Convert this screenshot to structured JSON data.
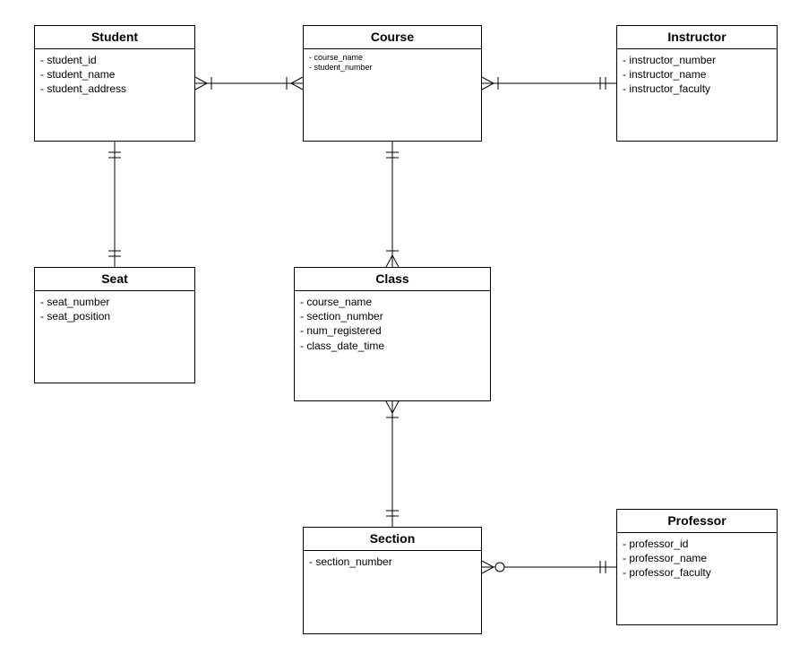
{
  "entities": {
    "student": {
      "title": "Student",
      "attributes": [
        "- student_id",
        "- student_name",
        "- student_address"
      ]
    },
    "course": {
      "title": "Course",
      "attributes": [
        "- course_name",
        "- student_number"
      ]
    },
    "instructor": {
      "title": "Instructor",
      "attributes": [
        "- instructor_number",
        "- instructor_name",
        "- instructor_faculty"
      ]
    },
    "seat": {
      "title": "Seat",
      "attributes": [
        "- seat_number",
        "- seat_position"
      ]
    },
    "class": {
      "title": "Class",
      "attributes": [
        "- course_name",
        "- section_number",
        "- num_registered",
        "- class_date_time"
      ]
    },
    "section": {
      "title": "Section",
      "attributes": [
        "- section_number"
      ]
    },
    "professor": {
      "title": "Professor",
      "attributes": [
        "- professor_id",
        "- professor_name",
        "- professor_faculty"
      ]
    }
  },
  "relationships": [
    {
      "from": "Student",
      "to": "Course",
      "fromCard": "many-mandatory",
      "toCard": "many-mandatory"
    },
    {
      "from": "Course",
      "to": "Instructor",
      "fromCard": "many-mandatory",
      "toCard": "one-mandatory"
    },
    {
      "from": "Student",
      "to": "Seat",
      "fromCard": "one-mandatory",
      "toCard": "one-mandatory"
    },
    {
      "from": "Course",
      "to": "Class",
      "fromCard": "one-mandatory",
      "toCard": "many-mandatory"
    },
    {
      "from": "Class",
      "to": "Section",
      "fromCard": "many-mandatory",
      "toCard": "one-mandatory"
    },
    {
      "from": "Section",
      "to": "Professor",
      "fromCard": "many-optional",
      "toCard": "one-mandatory"
    }
  ]
}
